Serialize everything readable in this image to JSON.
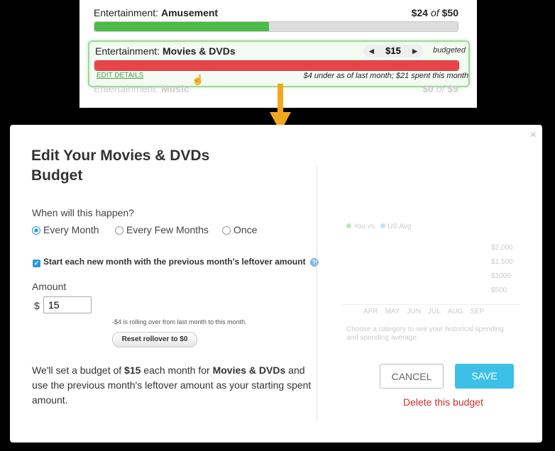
{
  "top": {
    "row1": {
      "category": "Entertainment:",
      "name": "Amusement",
      "amount": "$24",
      "of": "of",
      "total": "$50",
      "progress": 0.48
    },
    "row2": {
      "category": "Entertainment:",
      "name": "Movies & DVDs",
      "stepper_value": "$15",
      "budgeted_label": "budgeted",
      "edit_label": "EDIT DETAILS",
      "note": "$4 under as of last month; $21 spent this month",
      "progress": 1.0
    },
    "row3": {
      "category": "Entertainment:",
      "name": "Music",
      "amount": "$0",
      "of": "of",
      "total": "$9"
    }
  },
  "colors": {
    "green": "#4cbb47",
    "red": "#e8454a",
    "accent": "#3dc0e8",
    "delete": "#c9302c"
  },
  "modal": {
    "title": "Edit Your Movies & DVDs Budget",
    "close": "×",
    "question": "When will this happen?",
    "options": [
      "Every Month",
      "Every Few Months",
      "Once"
    ],
    "selected_option": "Every Month",
    "checkbox_label": "Start each new month with the previous month's leftover amount",
    "checkbox_checked": true,
    "amount_label": "Amount",
    "currency": "$",
    "amount_value": "15",
    "rollover_note": "-$4 is rolling over from last month to this month.",
    "reset_button": "Reset rollover to $0",
    "summary_pre": "We'll set a budget of ",
    "summary_amount": "$15",
    "summary_mid": " each month for ",
    "summary_name": "Movies & DVDs",
    "summary_post": " and use the previous month's leftover amount as your starting spent amount.",
    "chart": {
      "legend_you": "You vs.",
      "legend_us": "US Avg",
      "y_labels": [
        "$2,000",
        "$1,500",
        "$1000",
        "$500"
      ],
      "months": [
        "APR",
        "MAY",
        "JUN",
        "JUL",
        "AUG",
        "SEP"
      ],
      "hint": "Choose a category to see your historical spending and spending average."
    },
    "cancel_button": "CANCEL",
    "save_button": "SAVE",
    "delete_link": "Delete this budget"
  }
}
